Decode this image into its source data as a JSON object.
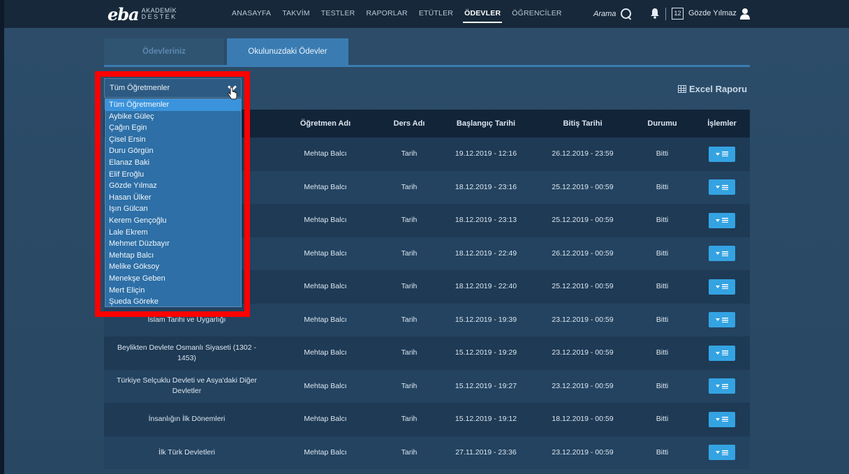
{
  "brand": {
    "mark": "eba",
    "line1": "AKADEMİK",
    "line2": "DESTEK"
  },
  "nav": {
    "items": [
      "ANASAYFA",
      "TAKVİM",
      "TESTLER",
      "RAPORLAR",
      "ETÜTLER",
      "ÖDEVLER",
      "ÖĞRENCİLER"
    ],
    "active": "ÖDEVLER"
  },
  "header": {
    "search_label": "Arama",
    "calendar_day": "12",
    "user_name": "Gözde Yılmaz"
  },
  "tabs": [
    "Ödevleriniz",
    "Okulunuzdaki Ödevler"
  ],
  "toolbar": {
    "excel_label": "Excel Raporu"
  },
  "dropdown": {
    "selected": "Tüm Öğretmenler",
    "options": [
      "Tüm Öğretmenler",
      "Aybike Güleç",
      "Çağın Egin",
      "Çisel Ersin",
      "Duru Görgün",
      "Elanaz Baki",
      "Elif Eroğlu",
      "Gözde Yılmaz",
      "Hasan Ülker",
      "Işın Gülcan",
      "Kerem Gençoğlu",
      "Lale Ekrem",
      "Mehmet Düzbayır",
      "Mehtap Balcı",
      "Melike Göksoy",
      "Menekşe Geben",
      "Mert Eliçin",
      "Şueda Göreke"
    ]
  },
  "table": {
    "columns": [
      "",
      "Öğretmen Adı",
      "Ders Adı",
      "Başlangıç Tarihi",
      "Bitiş Tarihi",
      "Durumu",
      "İşlemler"
    ],
    "rows": [
      {
        "topic": "",
        "teacher": "Mehtap Balcı",
        "course": "Tarih",
        "start": "19.12.2019 - 12:16",
        "end": "26.12.2019 - 23:59",
        "status": "Bitti"
      },
      {
        "topic": "",
        "teacher": "Mehtap Balcı",
        "course": "Tarih",
        "start": "18.12.2019 - 23:16",
        "end": "25.12.2019 - 00:59",
        "status": "Bitti"
      },
      {
        "topic": "",
        "teacher": "Mehtap Balcı",
        "course": "Tarih",
        "start": "18.12.2019 - 23:13",
        "end": "25.12.2019 - 00:59",
        "status": "Bitti"
      },
      {
        "topic": "",
        "teacher": "Mehtap Balcı",
        "course": "Tarih",
        "start": "18.12.2019 - 22:49",
        "end": "26.12.2019 - 00:59",
        "status": "Bitti"
      },
      {
        "topic": "",
        "teacher": "Mehtap Balcı",
        "course": "Tarih",
        "start": "18.12.2019 - 22:40",
        "end": "25.12.2019 - 00:59",
        "status": "Bitti"
      },
      {
        "topic": "İslam Tarihi ve Uygarlığı",
        "teacher": "Mehtap Balcı",
        "course": "Tarih",
        "start": "15.12.2019 - 19:39",
        "end": "23.12.2019 - 00:59",
        "status": "Bitti"
      },
      {
        "topic": "Beylikten Devlete Osmanlı Siyaseti (1302 - 1453)",
        "teacher": "Mehtap Balcı",
        "course": "Tarih",
        "start": "15.12.2019 - 19:29",
        "end": "23.12.2019 - 00:59",
        "status": "Bitti"
      },
      {
        "topic": "Türkiye Selçuklu Devleti ve Asya'daki Diğer Devletler",
        "teacher": "Mehtap Balcı",
        "course": "Tarih",
        "start": "15.12.2019 - 19:27",
        "end": "23.12.2019 - 00:59",
        "status": "Bitti"
      },
      {
        "topic": "İnsanlığın İlk Dönemleri",
        "teacher": "Mehtap Balcı",
        "course": "Tarih",
        "start": "15.12.2019 - 19:12",
        "end": "18.12.2019 - 00:59",
        "status": "Bitti"
      },
      {
        "topic": "İlk Türk Devletleri",
        "teacher": "Mehtap Balcı",
        "course": "Tarih",
        "start": "27.11.2019 - 23:36",
        "end": "23.12.2019 - 00:59",
        "status": "Bitti"
      }
    ]
  },
  "colors": {
    "accent": "#34a3e2",
    "highlight": "#ff0000",
    "topbar": "#17283a"
  }
}
